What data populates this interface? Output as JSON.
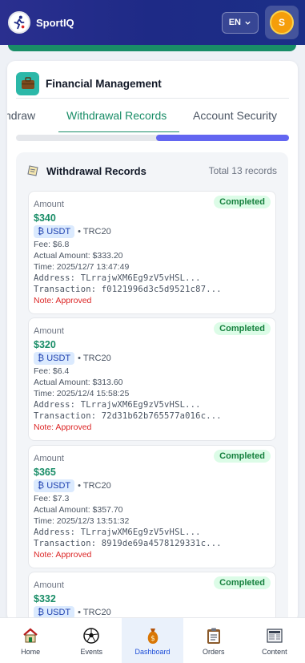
{
  "header": {
    "brand": "SportIQ",
    "language": "EN",
    "avatar_initial": "S",
    "logo_text": "SportIQ"
  },
  "financial": {
    "title": "Financial Management"
  },
  "tabs": [
    {
      "label": "ndraw",
      "active": false
    },
    {
      "label": "Withdrawal Records",
      "active": true
    },
    {
      "label": "Account Security",
      "active": false
    }
  ],
  "records": {
    "title": "Withdrawal Records",
    "total": "Total 13 records",
    "items": [
      {
        "amount_label": "Amount",
        "amount": "$340",
        "chip": "₿ USDT",
        "network": "• TRC20",
        "fee": "Fee: $6.8",
        "actual": "Actual Amount: $333.20",
        "time": "Time: 2025/12/7 13:47:49",
        "address": "Address: TLrrajwXM6Eg9zV5vHSL...",
        "transaction": "Transaction: f0121996d3c5d9521c87...",
        "note": "Note: Approved",
        "status": "Completed"
      },
      {
        "amount_label": "Amount",
        "amount": "$320",
        "chip": "₿ USDT",
        "network": "• TRC20",
        "fee": "Fee: $6.4",
        "actual": "Actual Amount: $313.60",
        "time": "Time: 2025/12/4 15:58:25",
        "address": "Address: TLrrajwXM6Eg9zV5vHSL...",
        "transaction": "Transaction: 72d31b62b765577a016c...",
        "note": "Note: Approved",
        "status": "Completed"
      },
      {
        "amount_label": "Amount",
        "amount": "$365",
        "chip": "₿ USDT",
        "network": "• TRC20",
        "fee": "Fee: $7.3",
        "actual": "Actual Amount: $357.70",
        "time": "Time: 2025/12/3 13:51:32",
        "address": "Address: TLrrajwXM6Eg9zV5vHSL...",
        "transaction": "Transaction: 8919de69a4578129331c...",
        "note": "Note: Approved",
        "status": "Completed"
      },
      {
        "amount_label": "Amount",
        "amount": "$332",
        "chip": "₿ USDT",
        "network": "• TRC20",
        "status": "Completed"
      }
    ]
  },
  "nav": [
    {
      "label": "Home",
      "icon": "home-icon"
    },
    {
      "label": "Events",
      "icon": "soccer-ball-icon"
    },
    {
      "label": "Dashboard",
      "icon": "money-bag-icon",
      "active": true
    },
    {
      "label": "Orders",
      "icon": "clipboard-icon"
    },
    {
      "label": "Content",
      "icon": "newspaper-icon"
    }
  ],
  "colors": {
    "header": "#1e2a86",
    "accent_green": "#198d67",
    "scroll_thumb": "#6366f1",
    "status_bg": "#dcfce7",
    "note_red": "#dc2626"
  }
}
